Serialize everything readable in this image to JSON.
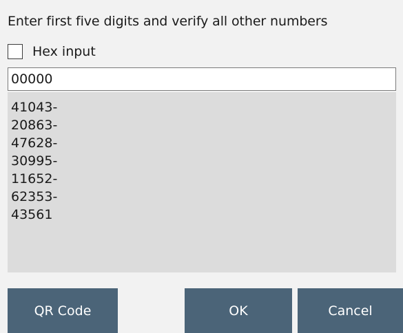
{
  "dialog": {
    "instruction": "Enter first five digits and verify all other numbers",
    "hex_input": {
      "label": "Hex input",
      "checked": false
    },
    "digits_field": {
      "value": "00000"
    },
    "numbers": [
      "41043-",
      "20863-",
      "47628-",
      "30995-",
      "11652-",
      "62353-",
      "43561"
    ]
  },
  "buttons": {
    "qr_code": "QR Code",
    "ok": "OK",
    "cancel": "Cancel"
  },
  "colors": {
    "button_bg": "#4b6478",
    "numbers_bg": "#dcdcdc",
    "dialog_bg": "#f2f2f2"
  }
}
